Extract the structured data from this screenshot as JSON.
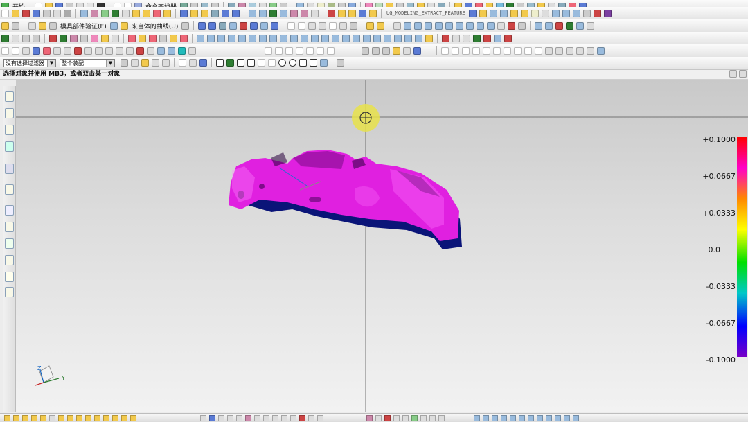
{
  "window": {
    "app_menu_label": "开始"
  },
  "toolbars": {
    "command_finder_label": "命令查找器",
    "feature_name_label": "UG_MODELING_EXTRACT_FEATURE",
    "mold_check_menu_label": "模具部件验证(E)",
    "solid_curve_menu_label": "来自体的曲线(U)"
  },
  "selection": {
    "filter_value": "没有选择过滤器",
    "scope_value": "整个装配"
  },
  "status": {
    "message": "选择对象并使用 MB3，或者双击某一对象"
  },
  "deviation_scale": {
    "labels": [
      "+0.1000",
      "+0.0667",
      "+0.0333",
      "0.0",
      "-0.0333",
      "-0.0667",
      "-0.1000"
    ],
    "colors": [
      "#ff0000",
      "#ff00c8",
      "#ff8800",
      "#ffff00",
      "#00e000",
      "#00c8c8",
      "#0000ff",
      "#7800c8"
    ]
  },
  "model": {
    "color": "#e020e0",
    "shadow_color": "#0a1478"
  },
  "triad": {
    "axis_z": "Z",
    "axis_y": "Y"
  }
}
